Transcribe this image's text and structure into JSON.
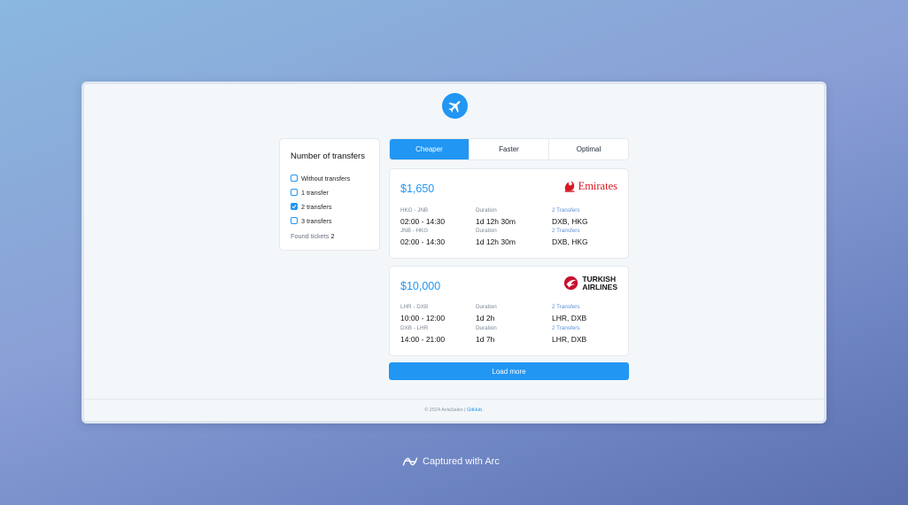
{
  "filter": {
    "title": "Number of transfers",
    "options": [
      {
        "label": "Without transfers",
        "checked": false
      },
      {
        "label": "1 transfer",
        "checked": false
      },
      {
        "label": "2 transfers",
        "checked": true
      },
      {
        "label": "3 transfers",
        "checked": false
      }
    ],
    "found_label": "Found tickets",
    "found_count": "2"
  },
  "tabs": [
    "Cheaper",
    "Faster",
    "Optimal"
  ],
  "active_tab": "Cheaper",
  "tickets": [
    {
      "price": "$1,650",
      "airline": "Emirates",
      "segments": [
        {
          "route": "HKG - JNB",
          "times": "02:00 - 14:30",
          "dur_label": "Duration",
          "duration": "1d 12h 30m",
          "transfers_label": "2 Transfers",
          "stops": "DXB, HKG"
        },
        {
          "route": "JNB - HKG",
          "times": "02:00 - 14:30",
          "dur_label": "Duration",
          "duration": "1d 12h 30m",
          "transfers_label": "2 Transfers",
          "stops": "DXB, HKG"
        }
      ]
    },
    {
      "price": "$10,000",
      "airline_line1": "TURKISH",
      "airline_line2": "AIRLINES",
      "segments": [
        {
          "route": "LHR - DXB",
          "times": "10:00 - 12:00",
          "dur_label": "Duration",
          "duration": "1d 2h",
          "transfers_label": "2 Transfers",
          "stops": "LHR, DXB"
        },
        {
          "route": "DXB - LHR",
          "times": "14:00 - 21:00",
          "dur_label": "Duration",
          "duration": "1d 7h",
          "transfers_label": "2 Transfers",
          "stops": "LHR, DXB"
        }
      ]
    }
  ],
  "load_more": "Load more",
  "footer": {
    "text": "© 2024 AviaSales | ",
    "link": "GitHub."
  },
  "capture_label": "Captured with Arc",
  "colors": {
    "accent": "#2196f3",
    "emirates": "#d71921",
    "turkish": "#c8102e"
  }
}
